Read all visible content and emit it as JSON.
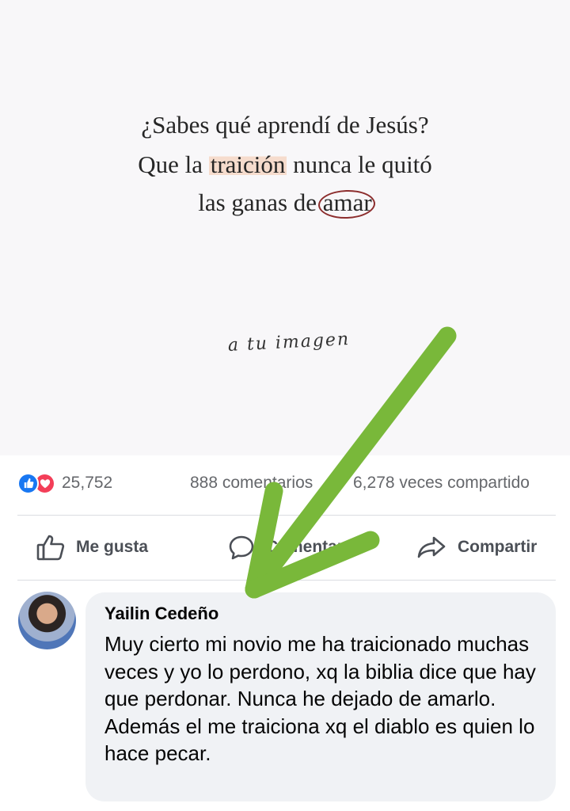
{
  "post": {
    "quote_line1": "¿Sabes qué aprendí de Jesús?",
    "quote_line2_pre": "Que la ",
    "quote_line2_highlight": "traición",
    "quote_line2_post": " nunca le quitó",
    "quote_line3_pre": "las ganas de ",
    "quote_line3_circled": "amar",
    "signature": "a tu imagen"
  },
  "reactions": {
    "count": "25,752",
    "comments": "888 comentarios",
    "shares": "6,278 veces compartido",
    "icons": [
      "like-icon",
      "love-icon"
    ]
  },
  "actions": {
    "like": "Me gusta",
    "comment": "Comentar",
    "share": "Compartir"
  },
  "comment": {
    "author": "Yailin Cedeño",
    "text": "Muy cierto mi novio me ha traicionado muchas veces y yo lo perdono, xq la biblia dice que hay que perdonar. Nunca he dejado de amarlo. Además el me traiciona xq el diablo es quien lo hace pecar."
  },
  "colors": {
    "arrow": "#79b83a",
    "like_blue": "#1877f2",
    "love_red": "#f33e58",
    "bubble": "#f0f2f5"
  }
}
